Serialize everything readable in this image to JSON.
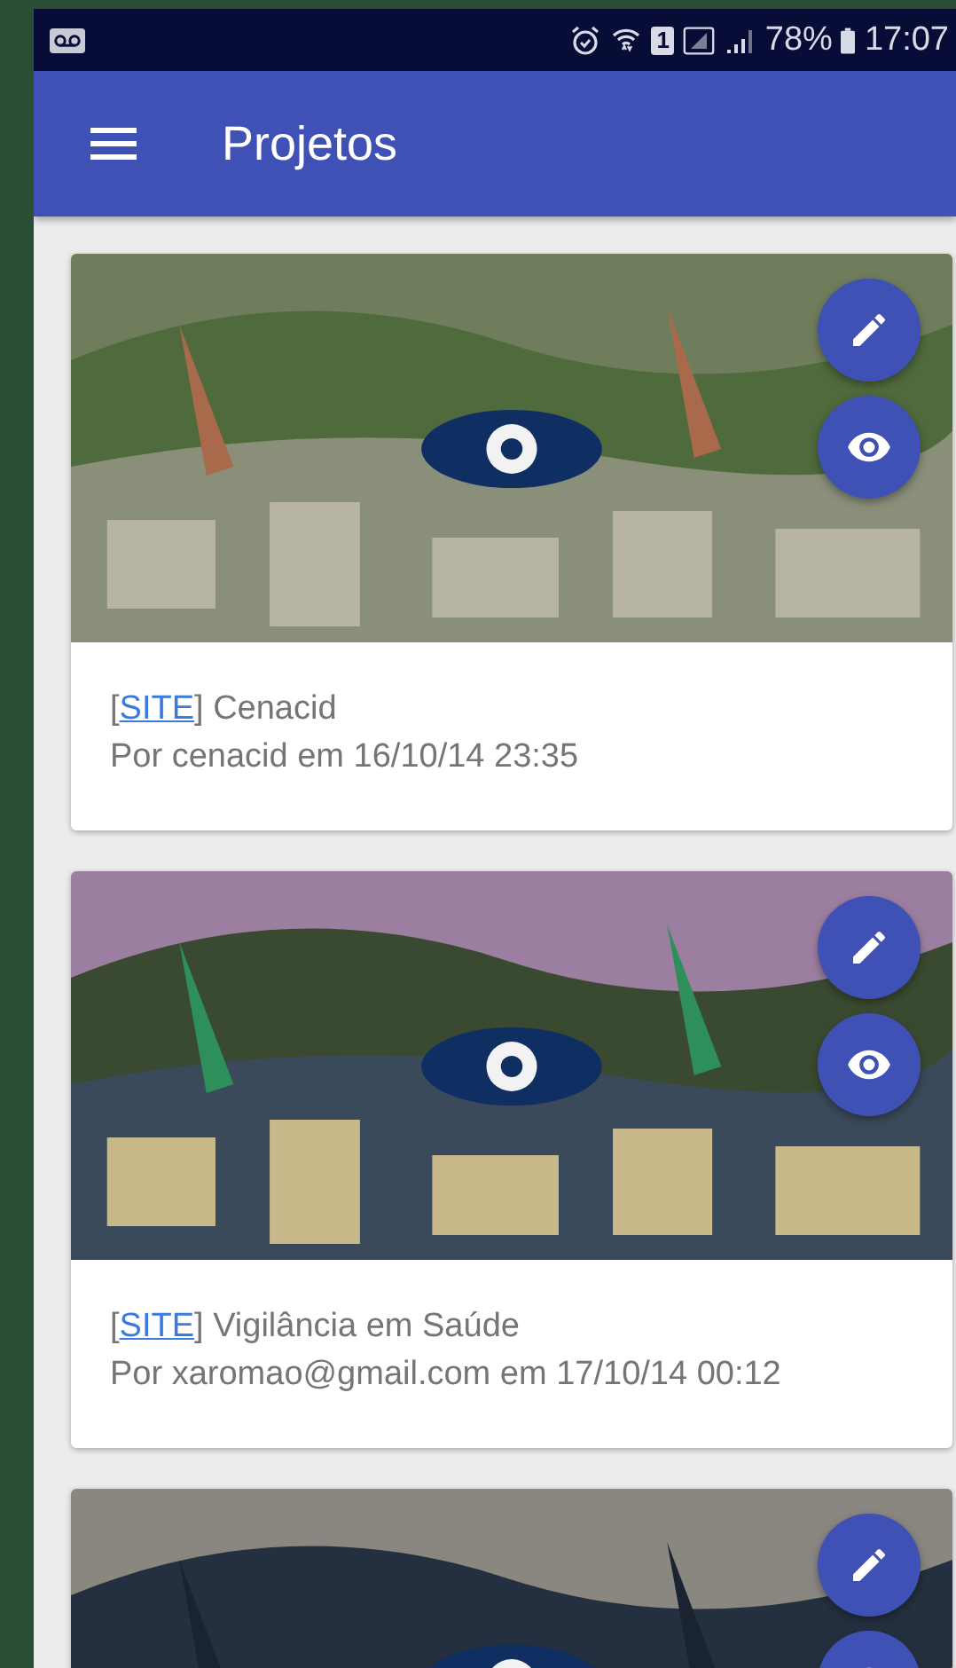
{
  "status_bar": {
    "sim_slot": "1",
    "battery": "78%",
    "time": "17:07"
  },
  "app_bar": {
    "title": "Projetos"
  },
  "projects": [
    {
      "kind": "picture",
      "bracket_open": "[",
      "tag": "SITE",
      "bracket_close": "]",
      "title": "Cenacid",
      "byline": "Por cenacid em 16/10/14 23:35"
    },
    {
      "kind": "picture",
      "bracket_open": "[",
      "tag": "SITE",
      "bracket_close": "]",
      "title": "Vigilância em Saúde",
      "byline": "Por xaromao@gmail.com em 17/10/14 00:12"
    },
    {
      "kind": "picture"
    }
  ]
}
